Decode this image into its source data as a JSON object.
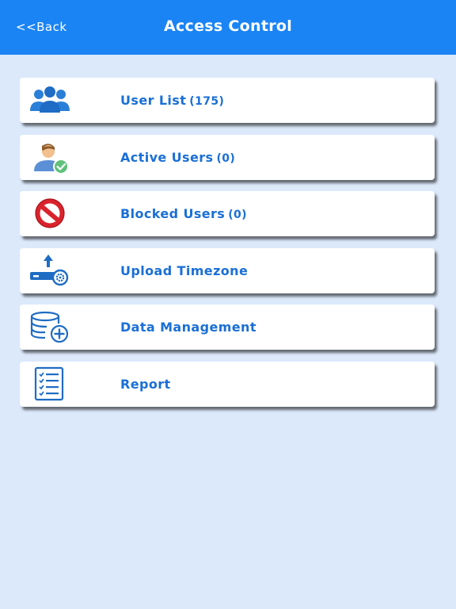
{
  "header": {
    "back_label": "<<Back",
    "title": "Access Control"
  },
  "menu": {
    "items": [
      {
        "label": "User List",
        "count": "(175)",
        "icon": "users-group-icon"
      },
      {
        "label": "Active Users",
        "count": "(0)",
        "icon": "active-user-icon"
      },
      {
        "label": "Blocked Users",
        "count": "(0)",
        "icon": "blocked-icon"
      },
      {
        "label": "Upload Timezone",
        "count": "",
        "icon": "upload-device-icon"
      },
      {
        "label": "Data Management",
        "count": "",
        "icon": "database-add-icon"
      },
      {
        "label": "Report",
        "count": "",
        "icon": "report-checklist-icon"
      }
    ]
  },
  "colors": {
    "header": "#1a84f5",
    "background": "#dce9fb",
    "label": "#1a6fd6"
  }
}
